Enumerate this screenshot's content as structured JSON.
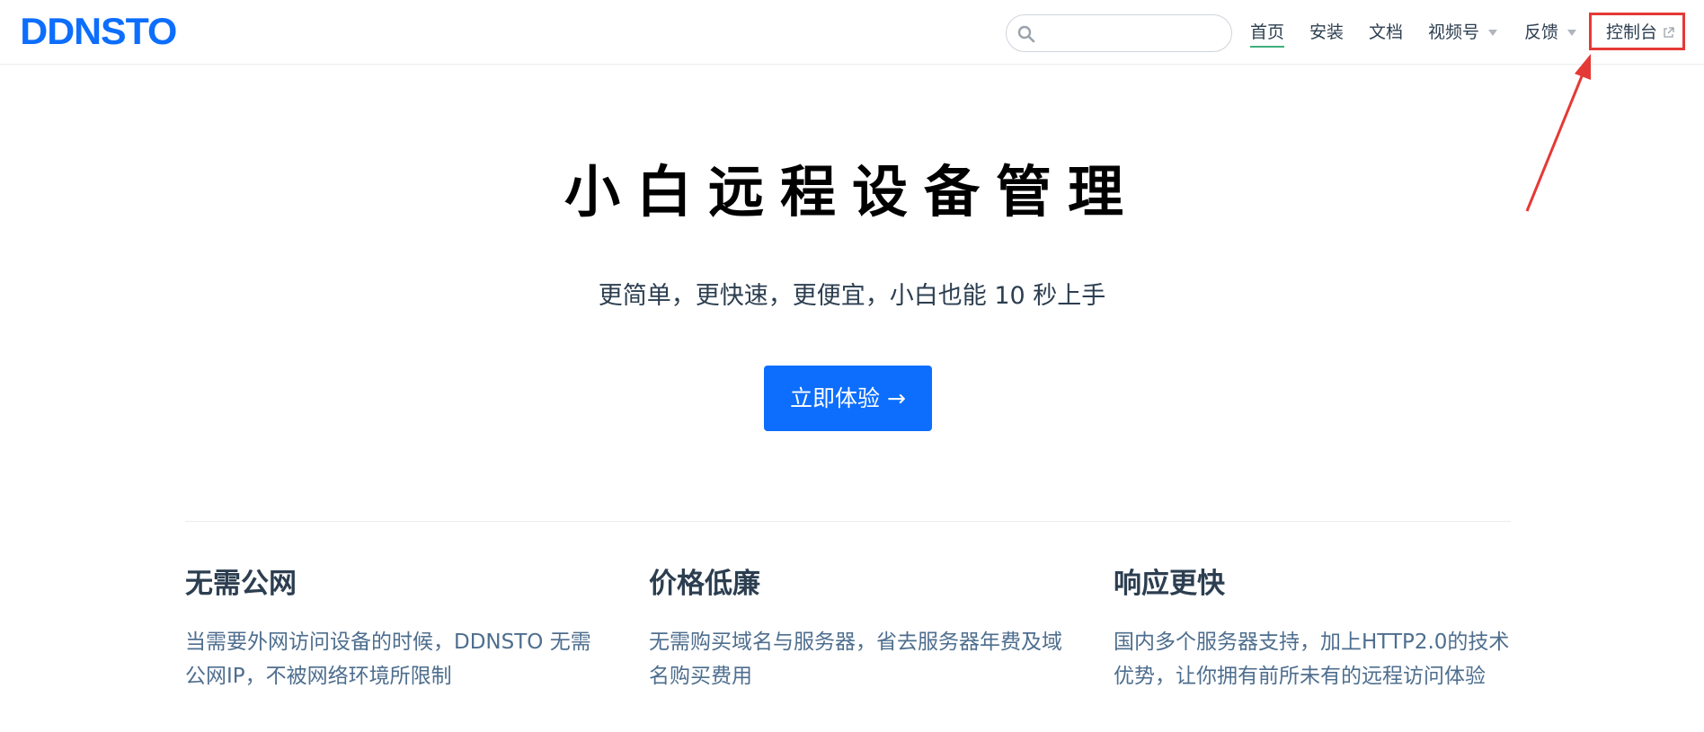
{
  "brand": {
    "logo_text": "DDNSTO",
    "accent": "#0d6efd"
  },
  "search": {
    "placeholder": "",
    "value": ""
  },
  "nav": {
    "items": [
      {
        "label": "首页",
        "active": true
      },
      {
        "label": "安装"
      },
      {
        "label": "文档"
      },
      {
        "label": "视频号",
        "dropdown": true
      },
      {
        "label": "反馈",
        "dropdown": true
      }
    ],
    "console_label": "控制台"
  },
  "hero": {
    "title": "小白远程设备管理",
    "subtitle": "更简单，更快速，更便宜，小白也能 10 秒上手",
    "cta_label": "立即体验 →"
  },
  "features": [
    {
      "title": "无需公网",
      "desc": "当需要外网访问设备的时候，DDNSTO 无需公网IP，不被网络环境所限制"
    },
    {
      "title": "价格低廉",
      "desc": "无需购买域名与服务器，省去服务器年费及域名购买费用"
    },
    {
      "title": "响应更快",
      "desc": "国内多个服务器支持，加上HTTP2.0的技术优势，让你拥有前所未有的远程访问体验"
    }
  ],
  "annotation_color": "#e53935"
}
